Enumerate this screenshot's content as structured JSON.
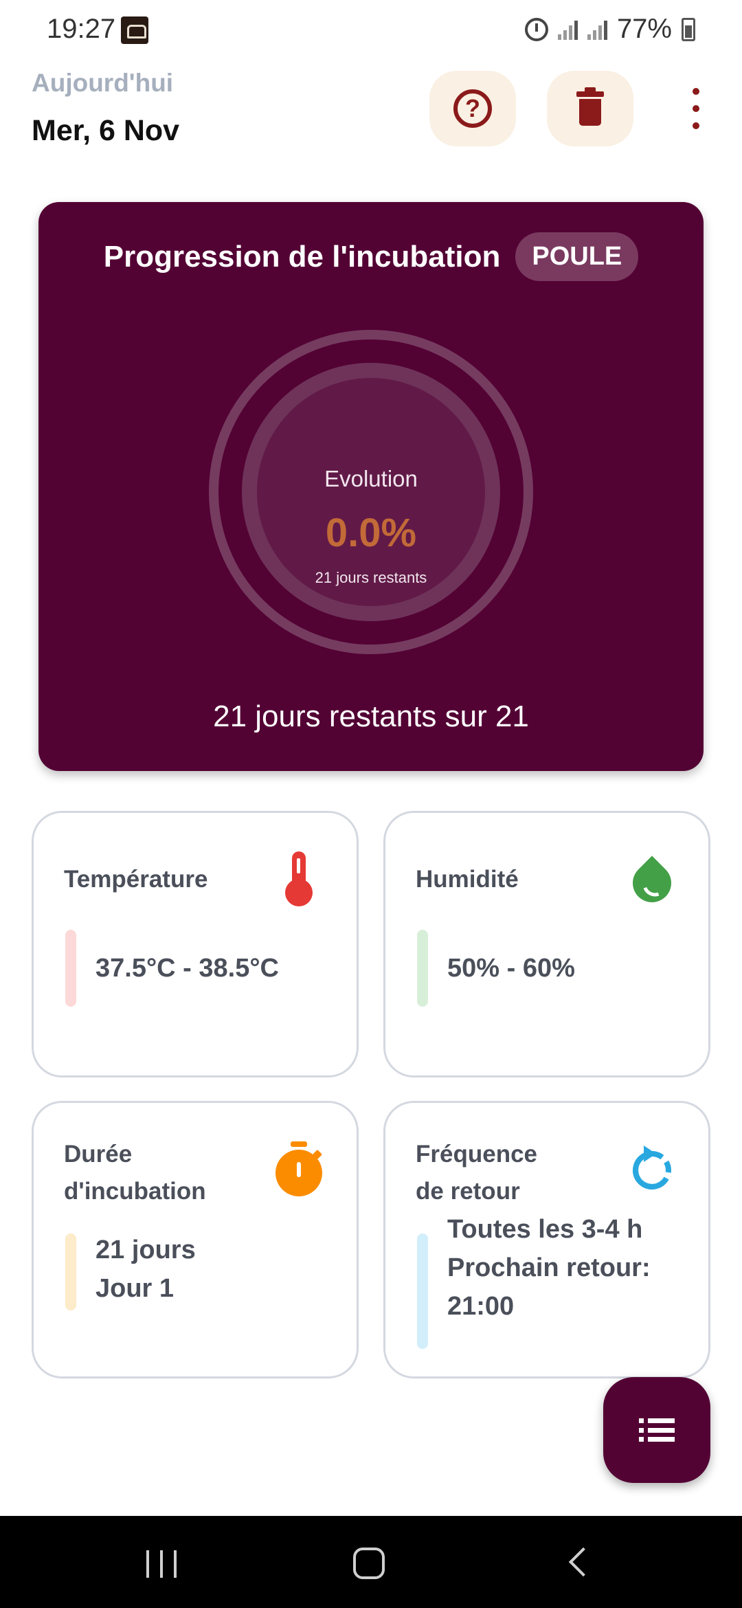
{
  "status_bar": {
    "time": "19:27",
    "battery": "77%",
    "icons": [
      "app-notification-icon",
      "alarm-icon",
      "signal-icon",
      "signal-icon",
      "battery-icon"
    ]
  },
  "header": {
    "subtitle": "Aujourd'hui",
    "date": "Mer, 6 Nov",
    "help_icon": "help-circle-icon",
    "delete_icon": "trash-icon",
    "menu_icon": "more-vertical-icon"
  },
  "progress": {
    "title": "Progression de l'incubation",
    "species": "POULE",
    "ring_label": "Evolution",
    "percent": "0.0%",
    "percent_value": 0.0,
    "remaining_short": "21 jours restants",
    "footer": "21 jours restants sur 21",
    "colors": {
      "card": "#530234",
      "percent": "#c26a38"
    }
  },
  "cards": {
    "temperature": {
      "title": "Température",
      "value": "37.5°C - 38.5°C",
      "icon": "thermometer-icon",
      "accent": "#e53935",
      "bar_color": "#fcd9d8"
    },
    "humidity": {
      "title": "Humidité",
      "value": "50% - 60%",
      "icon": "water-drop-icon",
      "accent": "#43a047",
      "bar_color": "#d7efd9"
    },
    "duration": {
      "title_line1": "Durée",
      "title_line2": "d'incubation",
      "value_line1": "21 jours",
      "value_line2": "Jour 1",
      "icon": "timer-icon",
      "accent": "#fb8c00",
      "bar_color": "#fdebc9"
    },
    "frequency": {
      "title_line1": "Fréquence",
      "title_line2": "de retour",
      "value_line1": "Toutes les 3-4 h",
      "value_line2": "Prochain retour:",
      "value_line3": "21:00",
      "icon": "refresh-icon",
      "accent": "#29a8e0",
      "bar_color": "#d2eefb"
    }
  },
  "fab": {
    "icon": "list-icon"
  },
  "nav": {
    "icons": [
      "recent-apps-icon",
      "home-icon",
      "back-icon"
    ]
  }
}
